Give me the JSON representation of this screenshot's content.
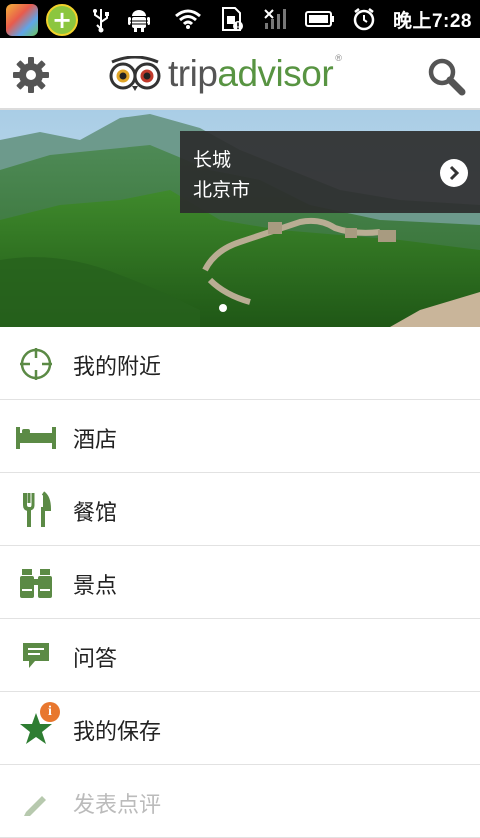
{
  "status_bar": {
    "time": "晚上7:28",
    "icons": [
      "app-store-icon",
      "plus-app-icon",
      "usb-icon",
      "android-debug-icon",
      "wifi-icon",
      "sim-warning-icon",
      "no-signal-icon",
      "battery-icon",
      "alarm-icon"
    ]
  },
  "header": {
    "logo_trip": "trip",
    "logo_advisor": "advisor",
    "logo_reg": "®",
    "icons": [
      "settings-gear-icon",
      "owl-eyes-logo-icon",
      "search-icon"
    ]
  },
  "hero": {
    "title": "长城",
    "subtitle": "北京市"
  },
  "menu": {
    "items": [
      {
        "label": "我的附近",
        "icon": "crosshair-icon"
      },
      {
        "label": "酒店",
        "icon": "bed-icon"
      },
      {
        "label": "餐馆",
        "icon": "fork-knife-icon"
      },
      {
        "label": "景点",
        "icon": "binoculars-icon"
      },
      {
        "label": "问答",
        "icon": "speech-bubble-icon"
      },
      {
        "label": "我的保存",
        "icon": "star-icon",
        "badge": "i"
      },
      {
        "label": "发表点评",
        "icon": "pencil-icon"
      }
    ]
  },
  "colors": {
    "accent_green": "#589442",
    "icon_green": "#5b8a45",
    "badge_orange": "#e8772e"
  }
}
